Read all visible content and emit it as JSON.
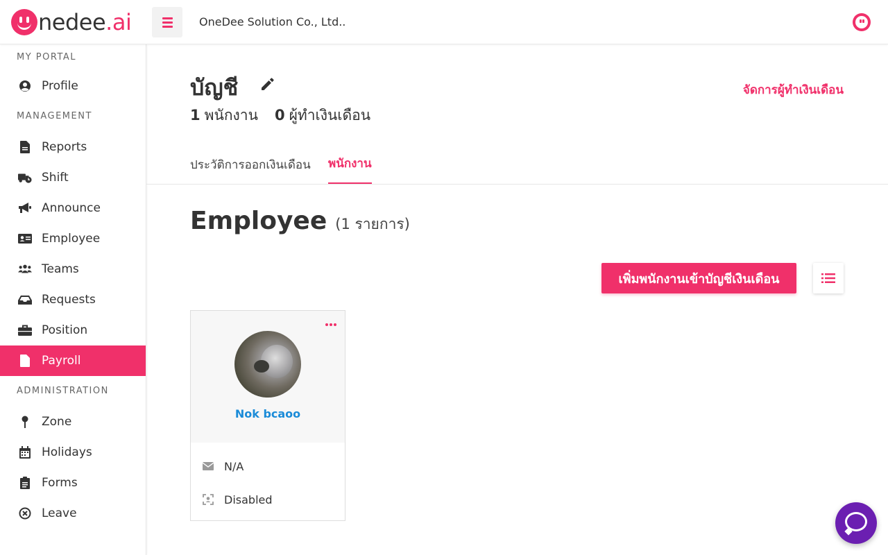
{
  "topbar": {
    "logo_text_prefix": "nedee",
    "logo_text_suffix": ".ai",
    "company": "OneDee Solution Co., Ltd.."
  },
  "sidebar": {
    "sections": {
      "portal": "MY PORTAL",
      "management": "MANAGEMENT",
      "administration": "ADMINISTRATION"
    },
    "items": {
      "profile": "Profile",
      "reports": "Reports",
      "shift": "Shift",
      "announce": "Announce",
      "employee": "Employee",
      "teams": "Teams",
      "requests": "Requests",
      "position": "Position",
      "payroll": "Payroll",
      "zone": "Zone",
      "holidays": "Holidays",
      "forms": "Forms",
      "leave": "Leave"
    }
  },
  "account": {
    "title": "บัญชี",
    "employee_count": "1",
    "employee_label": "พนักงาน",
    "payroll_maker_count": "0",
    "payroll_maker_label": "ผู้ทำเงินเดือน",
    "manage_link": "จัดการผู้ทำเงินเดือน"
  },
  "tabs": {
    "history": "ประวัติการออกเงินเดือน",
    "employees": "พนักงาน"
  },
  "employee_section": {
    "heading": "Employee",
    "count_text": "(1 รายการ)",
    "add_button": "เพิ่มพนักงานเข้าบัญชีเงินเดือน"
  },
  "card": {
    "name": "Nok bcaoo",
    "email": "N/A",
    "face_status": "Disabled"
  },
  "colors": {
    "accent": "#f0306a",
    "link_blue": "#1a8bd8",
    "chat": "#6b1fb1"
  }
}
